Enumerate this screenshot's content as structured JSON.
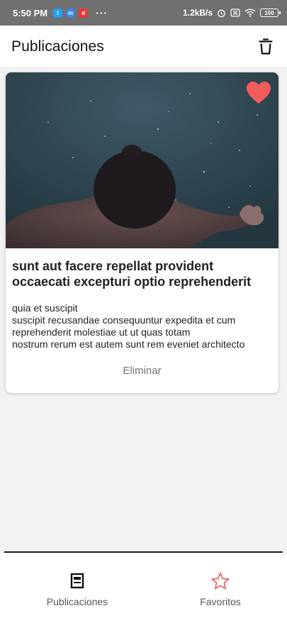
{
  "status_bar": {
    "time": "5:50 PM",
    "app_icons": [
      "twitter-icon",
      "messenger-icon",
      "app-red-icon"
    ],
    "more": "···",
    "network_speed": "1.2kB/s",
    "battery": "100"
  },
  "header": {
    "title": "Publicaciones",
    "action_icon": "trash-icon"
  },
  "post": {
    "title": "sunt aut facere repellat provident occaecati excepturi optio reprehenderit",
    "body": "quia et suscipit\nsuscipit recusandae consequuntur expedita et cum reprehenderit molestiae ut ut quas totam\nnostrum rerum est autem sunt rem eveniet architecto",
    "favorite": true,
    "favorite_color": "#f25c5c",
    "delete_label": "Eliminar"
  },
  "bottom_nav": {
    "items": [
      {
        "label": "Publicaciones",
        "icon": "document-icon"
      },
      {
        "label": "Favoritos",
        "icon": "star-icon",
        "color": "#e57373"
      }
    ]
  }
}
